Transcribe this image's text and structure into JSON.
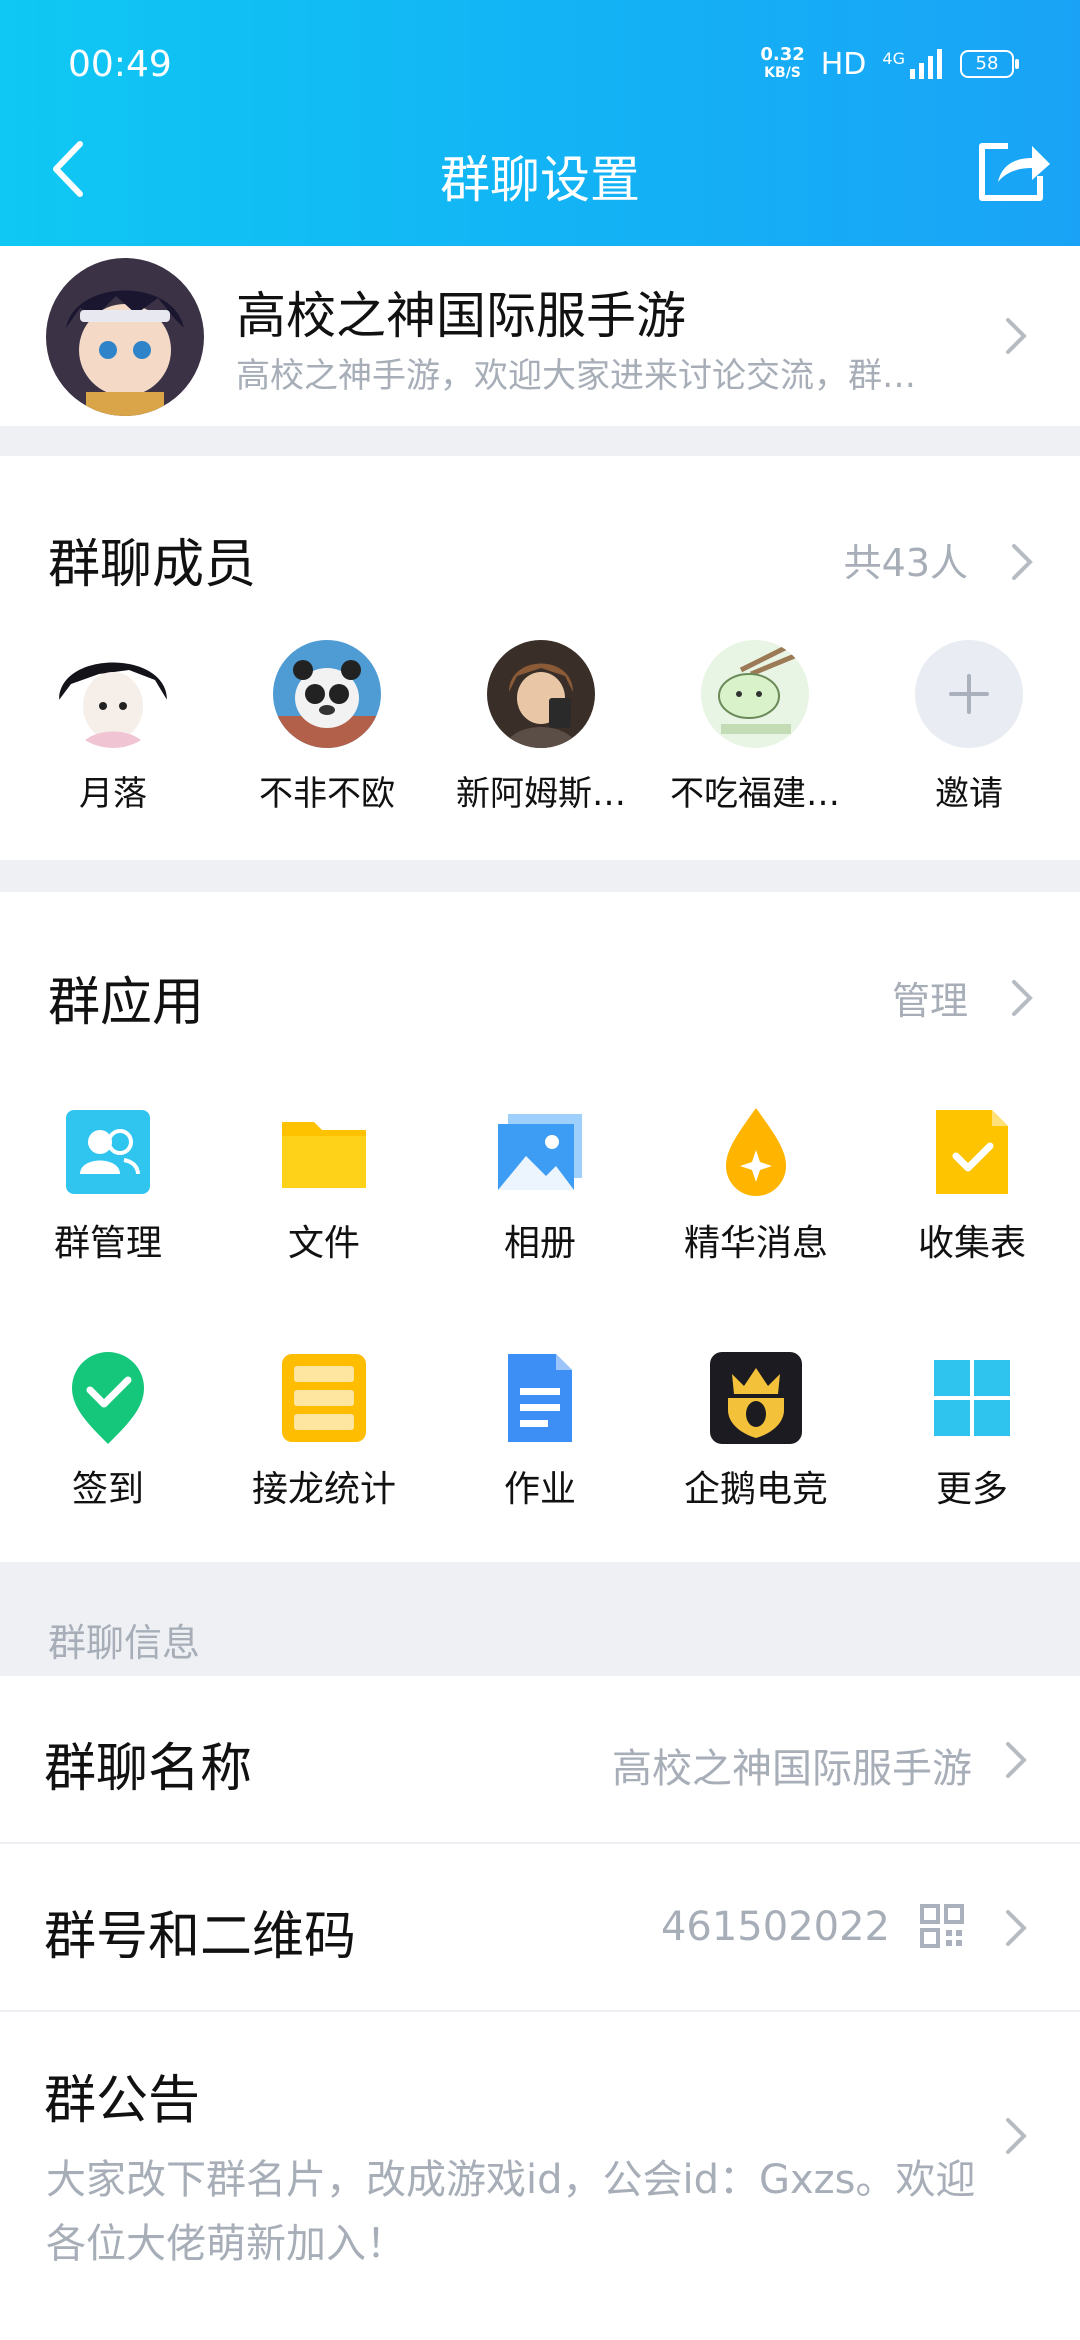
{
  "status_bar": {
    "time": "00:49",
    "speed_value": "0.32",
    "speed_unit": "KB/S",
    "hd": "HD",
    "network": "4G",
    "battery": "58"
  },
  "nav": {
    "title": "群聊设置"
  },
  "group": {
    "name": "高校之神国际服手游",
    "description": "高校之神手游，欢迎大家进来讨论交流，群…"
  },
  "members": {
    "title": "群聊成员",
    "count": "共43人",
    "list": [
      {
        "name": "月落"
      },
      {
        "name": "不非不欧"
      },
      {
        "name": "新阿姆斯…"
      },
      {
        "name": "不吃福建…"
      }
    ],
    "invite": "邀请"
  },
  "apps": {
    "title": "群应用",
    "manage": "管理",
    "items": [
      {
        "label": "群管理",
        "icon": "group-manage-icon"
      },
      {
        "label": "文件",
        "icon": "folder-icon"
      },
      {
        "label": "相册",
        "icon": "album-icon"
      },
      {
        "label": "精华消息",
        "icon": "essence-icon"
      },
      {
        "label": "收集表",
        "icon": "collect-form-icon"
      },
      {
        "label": "签到",
        "icon": "checkin-icon"
      },
      {
        "label": "接龙统计",
        "icon": "relay-stats-icon"
      },
      {
        "label": "作业",
        "icon": "homework-icon"
      },
      {
        "label": "企鹅电竞",
        "icon": "penguin-esports-icon"
      },
      {
        "label": "更多",
        "icon": "more-apps-icon"
      }
    ]
  },
  "info": {
    "header": "群聊信息",
    "name_label": "群聊名称",
    "name_value": "高校之神国际服手游",
    "number_label": "群号和二维码",
    "number_value": "461502022",
    "notice_label": "群公告",
    "notice_text": "大家改下群名片，改成游戏id，公会id：Gxzs。欢迎各位大佬萌新加入！"
  },
  "colors": {
    "header_start": "#0fc8f3",
    "header_end": "#1aa3f6",
    "secondary_text": "#a7aeb8",
    "page_bg": "#eef0f4"
  }
}
